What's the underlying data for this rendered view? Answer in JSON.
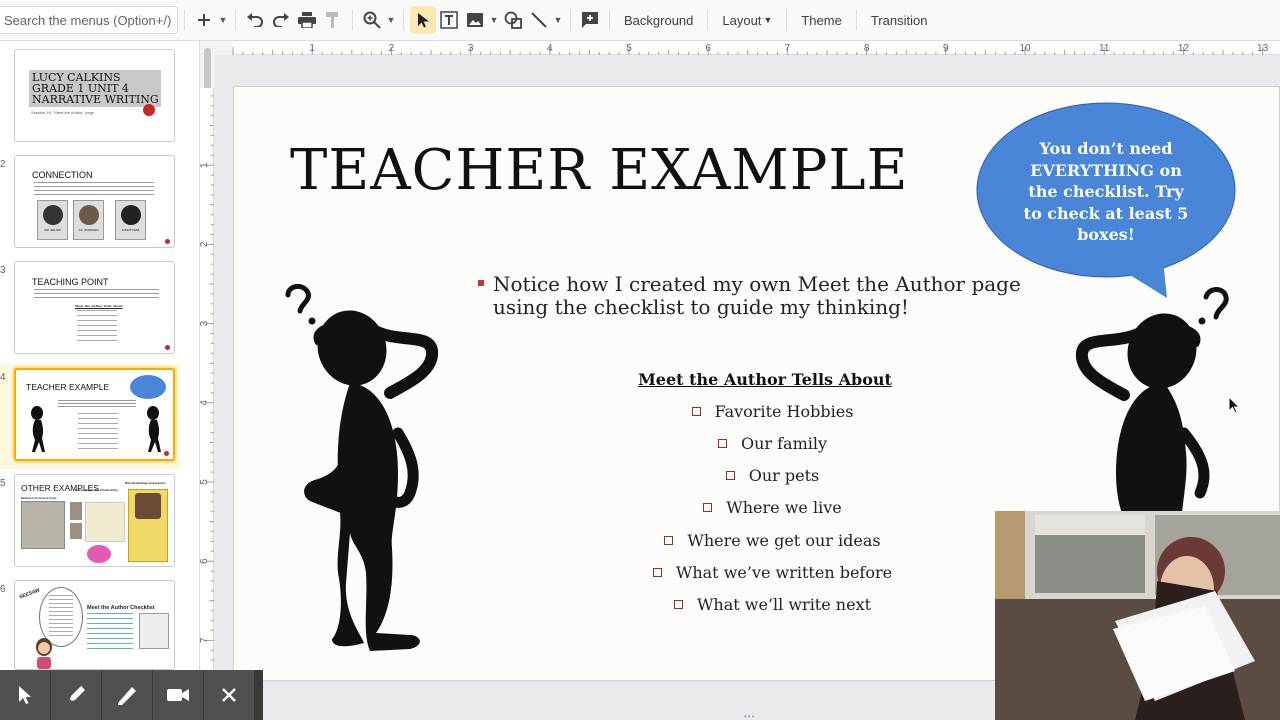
{
  "toolbar": {
    "search_placeholder": "Search the menus (Option+/)",
    "background_label": "Background",
    "layout_label": "Layout",
    "theme_label": "Theme",
    "transition_label": "Transition",
    "icons": [
      "plus-icon",
      "undo-icon",
      "redo-icon",
      "print-icon",
      "paint-format-icon",
      "zoom-icon",
      "select-icon",
      "textbox-icon",
      "image-icon",
      "shape-icon",
      "line-icon",
      "comment-add-icon"
    ]
  },
  "ruler": {
    "top_ticks": [
      "1",
      "2",
      "3",
      "4",
      "5",
      "6",
      "7",
      "8",
      "9",
      "10",
      "11",
      "12",
      "13"
    ],
    "left_ticks": [
      "1",
      "2",
      "3",
      "4",
      "5",
      "6",
      "7"
    ]
  },
  "sidebar": {
    "slides": [
      {
        "num": "",
        "title": "LUCY CALKINS\nGRADE 1 UNIT 4\nNARRATIVE WRITING",
        "subtitle": "Session 16: \"Meet the Author\" page"
      },
      {
        "num": "2",
        "title": "CONNECTION",
        "captions": [
          "DR. SEUSS",
          "J.K. ROWLING",
          "JUNOT DIAZ"
        ]
      },
      {
        "num": "3",
        "title": "TEACHING POINT",
        "subhead": "Meet the Author Tells About"
      },
      {
        "num": "4",
        "title": "TEACHER EXAMPLE"
      },
      {
        "num": "5",
        "title": "OTHER EXAMPLES",
        "sub_left": "Students from Grace & Jessie",
        "sub_mid": "Famous Brown: The Invisible String",
        "sub_right": "Marie Moeller/Sapp-Conrad author"
      },
      {
        "num": "6",
        "title": "Meet the Author Checklist",
        "badge": "SEESAW"
      }
    ]
  },
  "slide": {
    "title": "TEACHER EXAMPLE",
    "bullet": "Notice how I created my own Meet the Author page using the checklist to guide my thinking!",
    "list_heading": "Meet the Author Tells About",
    "list_items": [
      "Favorite Hobbies",
      "Our family",
      "Our pets",
      "Where we live",
      "Where we get our ideas",
      "What we’ve written before",
      "What we’ll write next"
    ],
    "bubble_text": "You don’t need EVERYTHING on the checklist. Try to check at least 5 boxes!"
  },
  "colors": {
    "bubble": "#4a86d8",
    "selected_thumb_border": "#f9ab00",
    "checkbox": "#9b2d20"
  },
  "bottom_bar": {
    "icons": [
      "pointer-icon",
      "pen-icon",
      "highlighter-icon",
      "camera-icon",
      "close-icon"
    ]
  }
}
